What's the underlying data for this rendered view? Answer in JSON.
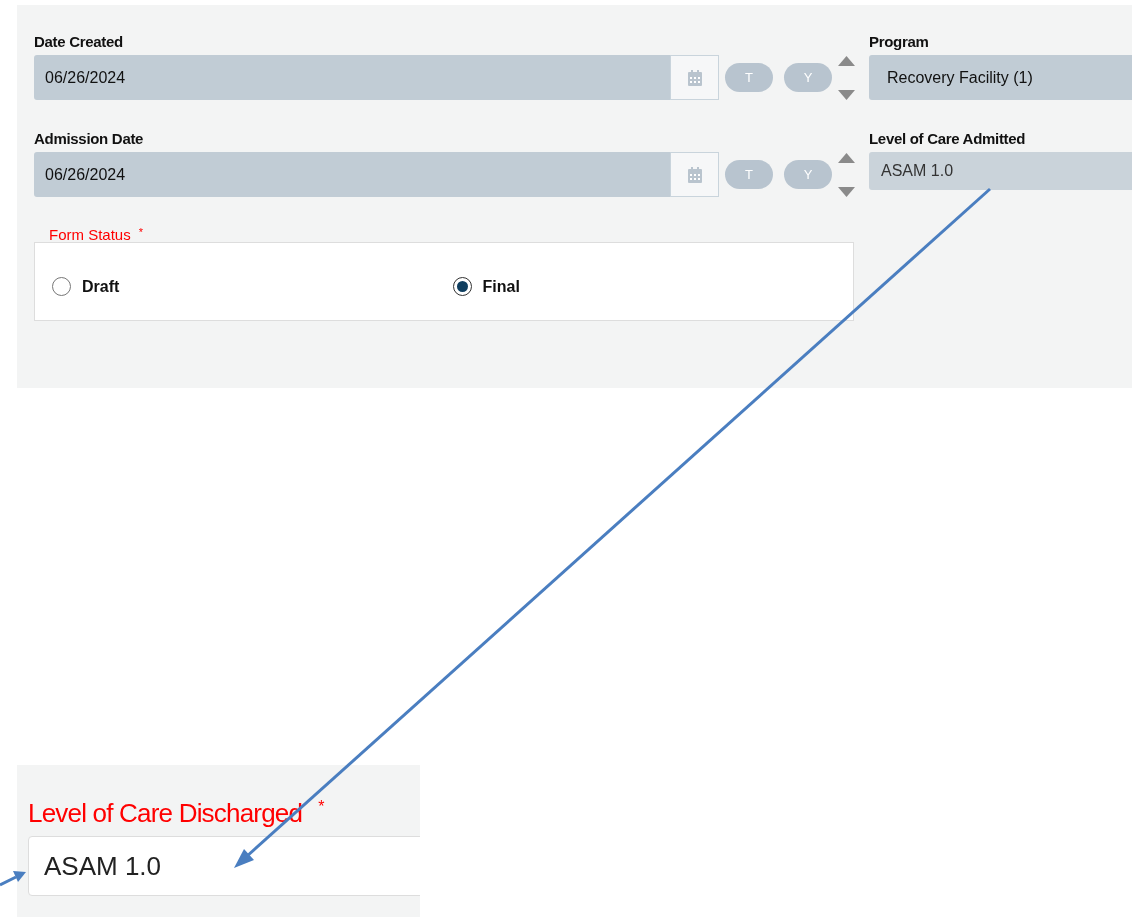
{
  "top_form": {
    "date_fields": [
      {
        "label": "Date Created",
        "value": "06/26/2024",
        "today_button": "T",
        "yesterday_button": "Y"
      },
      {
        "label": "Admission Date",
        "value": "06/26/2024",
        "today_button": "T",
        "yesterday_button": "Y"
      }
    ],
    "right_fields": [
      {
        "label": "Program",
        "value": "Recovery Facility (1)",
        "kind": "select"
      },
      {
        "label": "Level of Care Admitted",
        "value": "ASAM 1.0",
        "kind": "readonly"
      }
    ],
    "form_status": {
      "label": "Form Status",
      "required_mark": "*",
      "options": [
        {
          "label": "Draft",
          "selected": false
        },
        {
          "label": "Final",
          "selected": true
        }
      ]
    }
  },
  "discharge_panel": {
    "label": "Level of Care Discharged",
    "required_mark": "*",
    "value": "ASAM 1.0"
  }
}
